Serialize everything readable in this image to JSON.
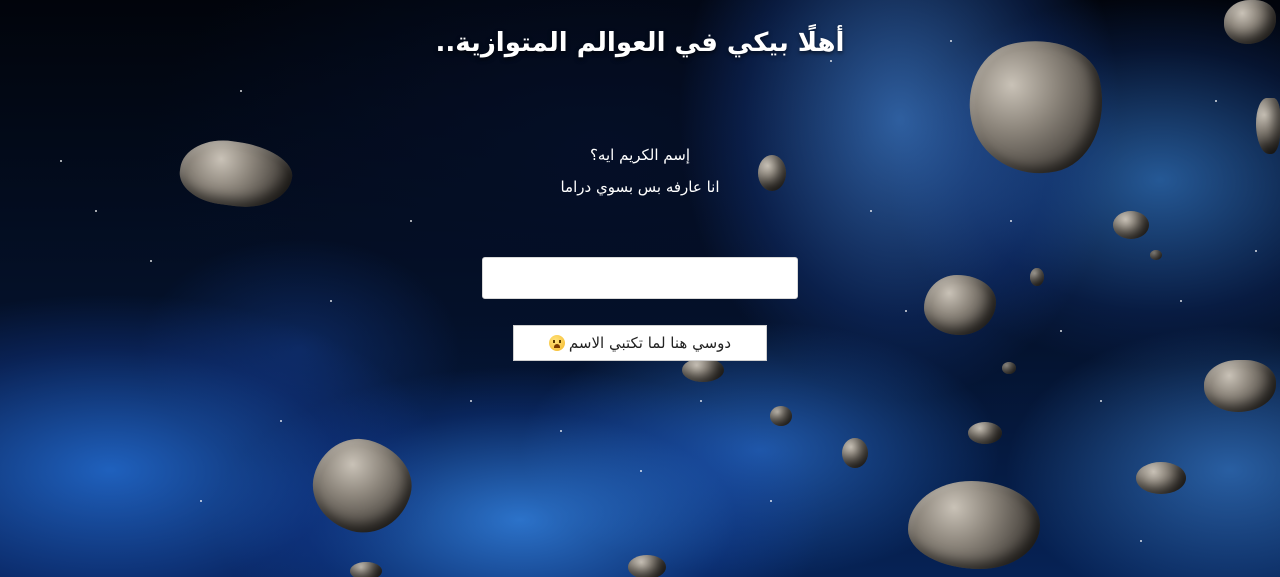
{
  "page": {
    "title": "أهلًا بيكي في العوالم المتوازية..",
    "question": "إسم الكريم ايه؟",
    "note": "انا عارفه بس بسوي دراما"
  },
  "form": {
    "name_value": "",
    "submit_label": "دوسي هنا لما تكتبي الاسم",
    "submit_icon": "scared-face-emoji-icon"
  },
  "colors": {
    "text": "#ffffff",
    "button_bg": "#ffffff",
    "space_deep": "#02050c",
    "nebula_blue": "#2f7ee8"
  }
}
